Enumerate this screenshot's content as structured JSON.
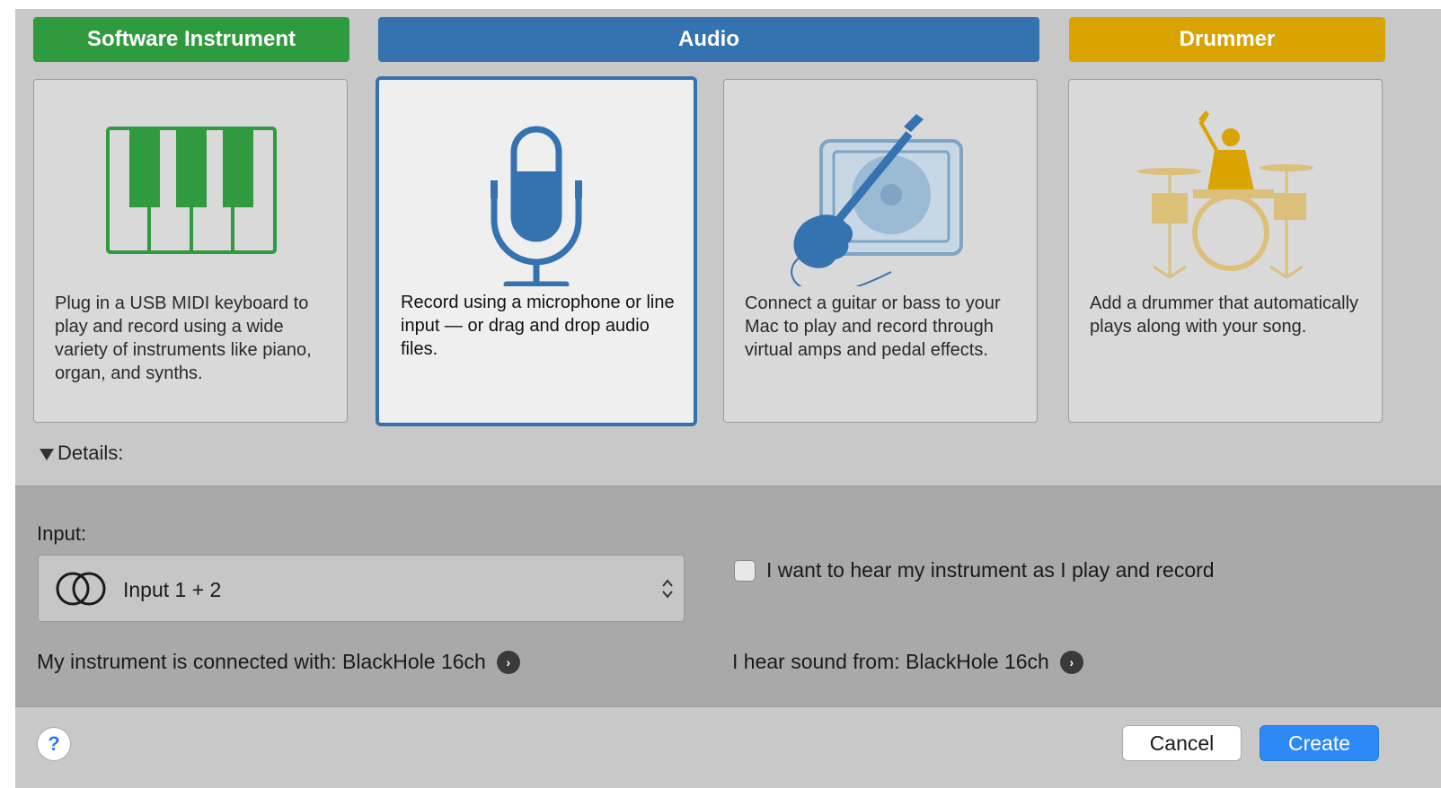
{
  "categories": {
    "software_instrument": "Software Instrument",
    "audio": "Audio",
    "drummer": "Drummer"
  },
  "cards": {
    "software": {
      "description": "Plug in a USB MIDI keyboard to play and record using a wide variety of instruments like piano, organ, and synths.",
      "icon": "piano-keys-icon"
    },
    "microphone": {
      "description": "Record using a microphone or line input — or drag and drop audio files.",
      "icon": "microphone-icon",
      "selected": true
    },
    "guitar": {
      "description": "Connect a guitar or bass to your Mac to play and record through virtual amps and pedal effects.",
      "icon": "guitar-amp-icon"
    },
    "drummer": {
      "description": "Add a drummer that automatically plays along with your song.",
      "icon": "drummer-icon"
    }
  },
  "details": {
    "toggle_label": "Details:",
    "input_label": "Input:",
    "input_value": "Input 1 + 2",
    "monitor_label": "I want to hear my instrument as I play and record",
    "monitor_checked": false,
    "connected_with": "My instrument is connected with: BlackHole 16ch",
    "hear_from": "I hear sound from: BlackHole 16ch"
  },
  "footer": {
    "help_label": "?",
    "cancel_label": "Cancel",
    "create_label": "Create"
  },
  "colors": {
    "software_green": "#2f9b3e",
    "audio_blue": "#3572b0",
    "drummer_gold": "#d9a300",
    "create_blue": "#2d89f5"
  }
}
